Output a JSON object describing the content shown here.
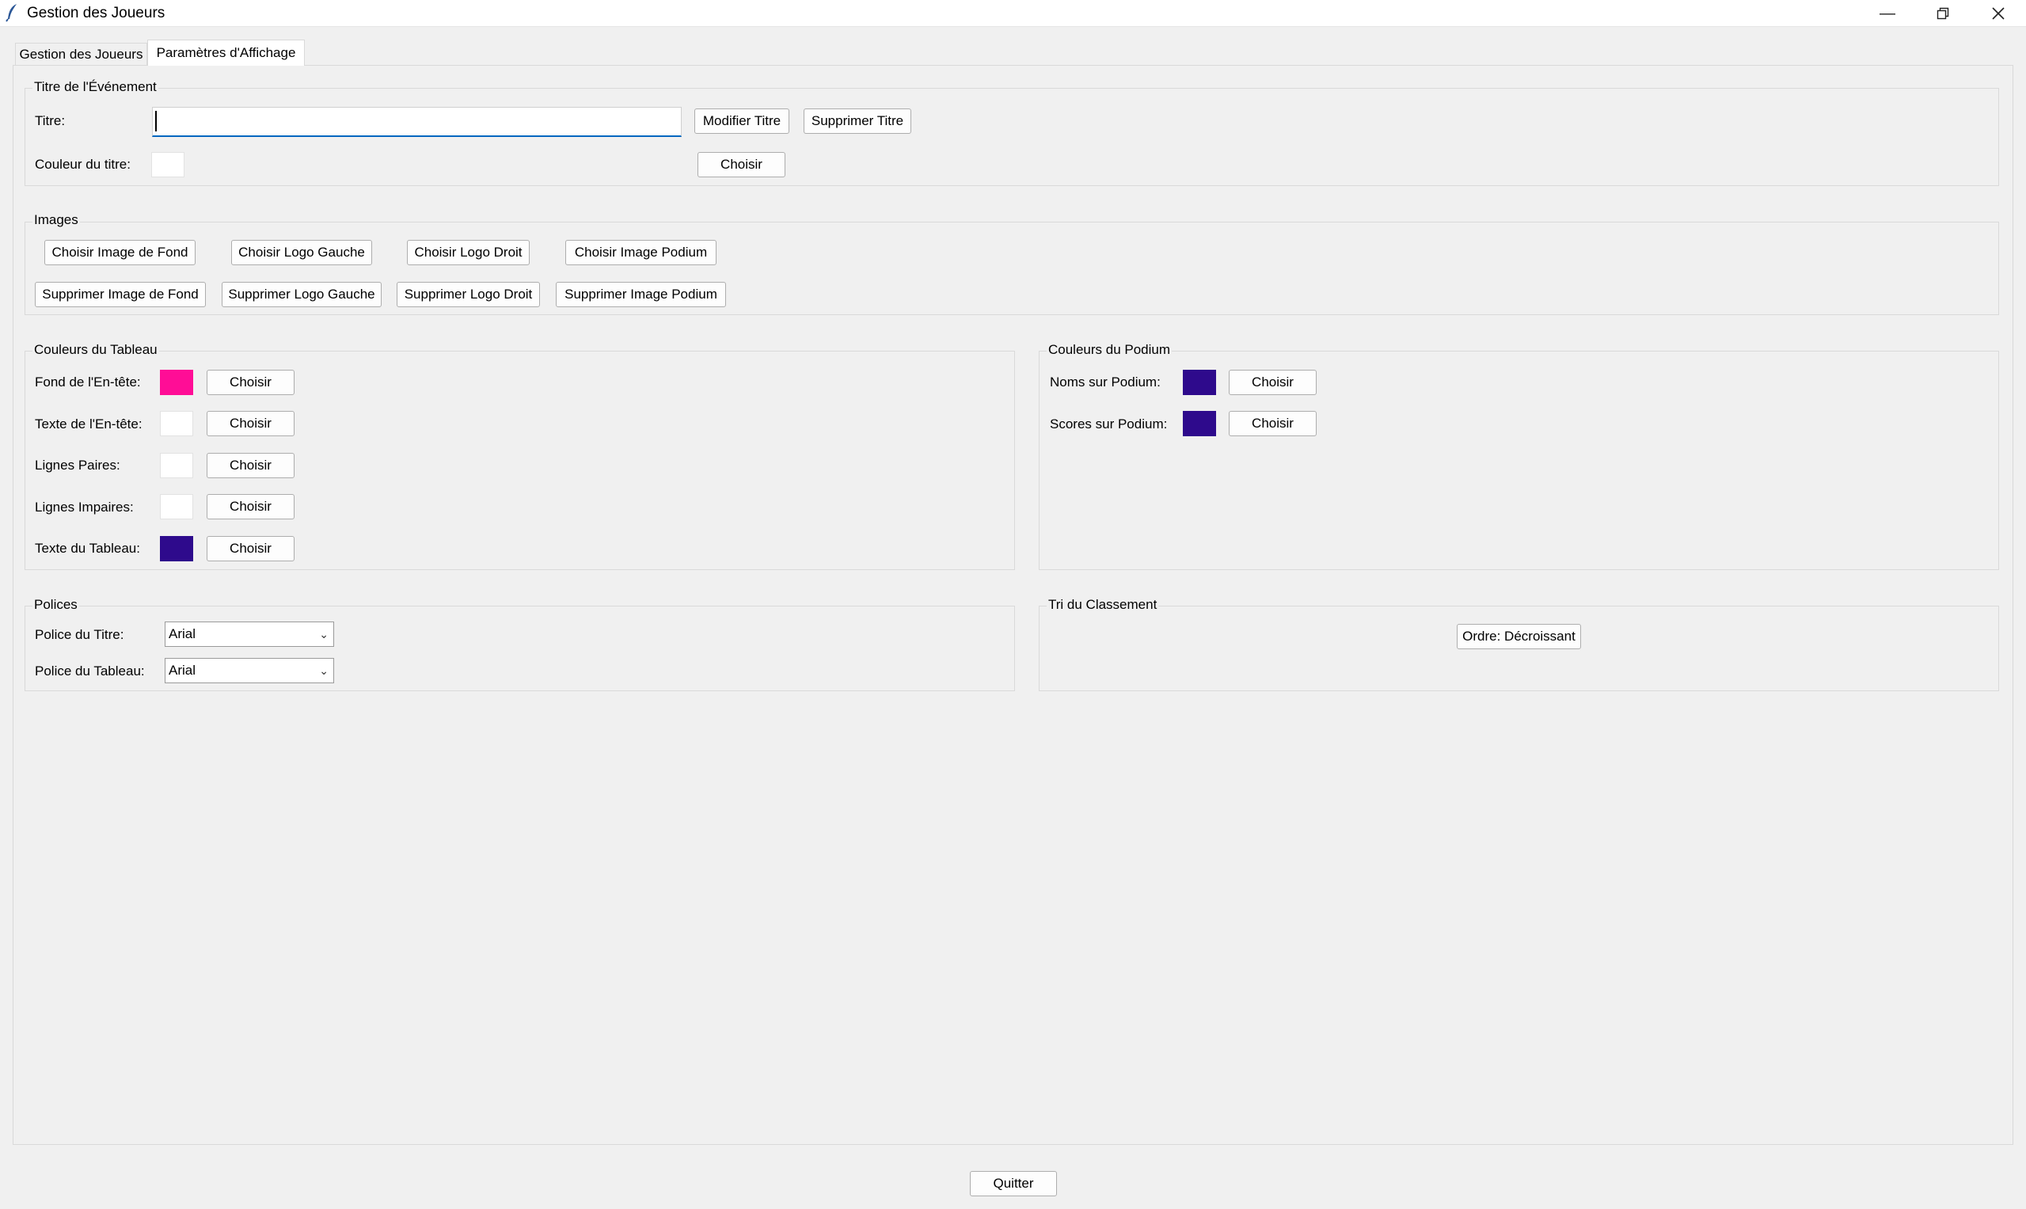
{
  "window": {
    "title": "Gestion des Joueurs"
  },
  "tabs": [
    {
      "label": "Gestion des Joueurs"
    },
    {
      "label": "Paramètres d'Affichage"
    }
  ],
  "event_title": {
    "frame_label": "Titre de l'Événement",
    "title_label": "Titre:",
    "title_value": "",
    "modify_button": "Modifier Titre",
    "delete_button": "Supprimer Titre",
    "color_label": "Couleur du titre:",
    "color": "#ffffff",
    "choose_button": "Choisir"
  },
  "images": {
    "frame_label": "Images",
    "choose_background": "Choisir Image de Fond",
    "choose_left_logo": "Choisir Logo Gauche",
    "choose_right_logo": "Choisir Logo Droit",
    "choose_podium_image": "Choisir Image Podium",
    "delete_background": "Supprimer Image de Fond",
    "delete_left_logo": "Supprimer Logo Gauche",
    "delete_right_logo": "Supprimer Logo Droit",
    "delete_podium_image": "Supprimer Image Podium"
  },
  "table_colors": {
    "frame_label": "Couleurs du Tableau",
    "choose_label": "Choisir",
    "rows": [
      {
        "label": "Fond de l'En-tête:",
        "color": "#ff0d96"
      },
      {
        "label": "Texte de l'En-tête:",
        "color": "#ffffff"
      },
      {
        "label": "Lignes Paires:",
        "color": "#ffffff"
      },
      {
        "label": "Lignes Impaires:",
        "color": "#ffffff"
      },
      {
        "label": "Texte du Tableau:",
        "color": "#2e0a8c"
      }
    ]
  },
  "podium_colors": {
    "frame_label": "Couleurs du Podium",
    "choose_label": "Choisir",
    "rows": [
      {
        "label": "Noms sur Podium:",
        "color": "#2e0a8c"
      },
      {
        "label": "Scores sur Podium:",
        "color": "#2e0a8c"
      }
    ]
  },
  "fonts": {
    "frame_label": "Polices",
    "title_font_label": "Police du Titre:",
    "title_font_value": "Arial",
    "table_font_label": "Police du Tableau:",
    "table_font_value": "Arial"
  },
  "sorting": {
    "frame_label": "Tri du Classement",
    "order_button": "Ordre: Décroissant"
  },
  "footer": {
    "quit_button": "Quitter"
  }
}
